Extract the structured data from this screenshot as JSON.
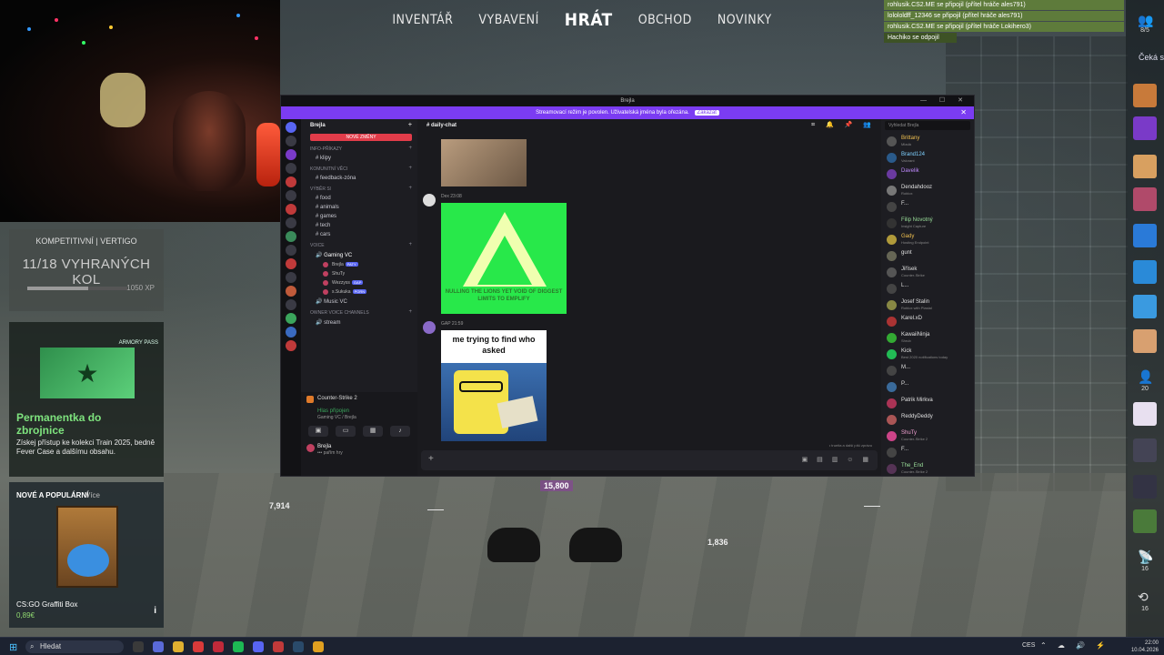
{
  "game": {
    "nav": [
      "INVENTÁŘ",
      "VYBAVENÍ",
      "HRÁT",
      "OBCHOD",
      "NOVINKY"
    ],
    "nav_active_index": 2,
    "competitive": {
      "title": "KOMPETITIVNÍ | VERTIGO",
      "wins": "11/18 VYHRANÝCH KOL",
      "xp": "1050 XP",
      "progress": 0.61
    },
    "pass": {
      "tag": "ARMORY PASS",
      "title": "Permanentka do zbrojnice",
      "text": "Získej přístup ke kolekci Train 2025, bedně Fever Case a dalšímu obsahu."
    },
    "new_popular": {
      "title": "NOVÉ A POPULÁRNÍ",
      "more": "Více",
      "item_name": "CS:GO Graffiti Box",
      "item_price": "0,89€"
    },
    "hud": {
      "money_1": "7,914",
      "money_2": "15,800",
      "money_3": "1,836",
      "blank_1": "——",
      "blank_2": "——"
    }
  },
  "chat_overlay": [
    "rohlusik.CS2.ME se připojil (přítel hráče ales791)",
    "lolololdff_12346 se připojil (přítel hráče ales791)",
    "rohlusik.CS2.ME se připojil (přítel hráče Lokihero3)",
    "Hachiko se odpojil"
  ],
  "right_bar": {
    "top_count": "8/5",
    "waiting": "Čeká s",
    "count_people": "20",
    "count_signal": "16",
    "count_history": "16"
  },
  "discord": {
    "title": "Brejla",
    "banner_text": "Streamovací režim je povolen. Uživatelská jména byla ořezána.",
    "banner_button": "Zakázat",
    "server_name": "Brejla",
    "new_messages": "NOVÉ ZMĚNY",
    "categories": [
      {
        "name": "INFO-PŘÍKAZY",
        "channels": [
          "klipy"
        ]
      },
      {
        "name": "KOMUNITNÍ VĚCI",
        "channels": [
          "feedback-zóna"
        ]
      },
      {
        "name": "VÝBĚR Sl",
        "channels": [
          "food",
          "animals",
          "games",
          "tech",
          "cars"
        ]
      },
      {
        "name": "VOICE",
        "channels": [
          "Gaming VC"
        ]
      }
    ],
    "voice_users": [
      {
        "name": "Brejla",
        "badge": "PATY"
      },
      {
        "name": "ShuTy",
        "badge": ""
      },
      {
        "name": "Wezzyss",
        "badge": "GAP"
      },
      {
        "name": "s.Sukuka",
        "badge": "PORN"
      }
    ],
    "music_vc": "Music VC",
    "owner_category": "OWNER VOICE CHANNELS",
    "stream_channel": "stream",
    "activity": "Counter-Strike 2",
    "voice_connected": "Hlas připojen",
    "voice_channel": "Gaming VC / Brejla",
    "user_name": "Brejla",
    "user_status": "••• pařím hry",
    "active_channel": "daily-chat",
    "search_placeholder": "Vyhledat Brejla",
    "msg_author_1": "Dex 23:08",
    "msg_author_2": "GAP 21:59",
    "green_caption": "NULLING THE LIONS YET VOID OF DIGGEST LIMITS TO EMPLIFY",
    "meme_text": "me trying to find who asked",
    "typing_text": "• trueita a další píší zprávu",
    "members": [
      {
        "name": "Brittany",
        "status": "Mladá",
        "color": "#f0c050",
        "av": "#555"
      },
      {
        "name": "Brand124",
        "status": "Valorant",
        "color": "#7ed0ff",
        "av": "#2a5a8a"
      },
      {
        "name": "Davelik",
        "status": "",
        "color": "#c08aff",
        "av": "#6a3aa0"
      },
      {
        "name": "Dendahdooz",
        "status": "Roblox",
        "color": "#e0e0e0",
        "av": "#777"
      },
      {
        "name": "F...",
        "status": "",
        "color": "#e0e0e0",
        "av": "#444"
      },
      {
        "name": "Filip Novotný",
        "status": "Insight Capture",
        "color": "#9adf9a",
        "av": "#333"
      },
      {
        "name": "Gady",
        "status": "Hosting Endpoint",
        "color": "#f0c050",
        "av": "#b09a3a"
      },
      {
        "name": "gunt",
        "status": "",
        "color": "#e0e0e0",
        "av": "#665"
      },
      {
        "name": "Jiřísek",
        "status": "Counter-Strike",
        "color": "#e0e0e0",
        "av": "#555"
      },
      {
        "name": "L...",
        "status": "",
        "color": "#e0e0e0",
        "av": "#444"
      },
      {
        "name": "Josef Stalin",
        "status": "Roblox with Plastal",
        "color": "#e0e0e0",
        "av": "#884"
      },
      {
        "name": "Karel.xD",
        "status": "",
        "color": "#e0e0e0",
        "av": "#a33"
      },
      {
        "name": "KawaiiNinja",
        "status": "Shrub",
        "color": "#e0e0e0",
        "av": "#3a3"
      },
      {
        "name": "Kick",
        "status": "Best 2020 notifications today",
        "color": "#e0e0e0",
        "av": "#2b5"
      },
      {
        "name": "M...",
        "status": "",
        "color": "#e0e0e0",
        "av": "#444"
      },
      {
        "name": "P...",
        "status": "",
        "color": "#e0e0e0",
        "av": "#3a6a9a"
      },
      {
        "name": "Patrik Mirkva",
        "status": "",
        "color": "#e0e0e0",
        "av": "#a35"
      },
      {
        "name": "ReddyDeddy",
        "status": "",
        "color": "#e0e0e0",
        "av": "#a55"
      },
      {
        "name": "ShuTy",
        "status": "Counter-Strike 2",
        "color": "#f0a0d0",
        "av": "#c48"
      },
      {
        "name": "F...",
        "status": "",
        "color": "#e0e0e0",
        "av": "#444"
      },
      {
        "name": "The_End",
        "status": "Counter-Strike 2",
        "color": "#9adf9a",
        "av": "#535"
      },
      {
        "name": "Wolfeer",
        "status": "",
        "color": "#e0e0e0",
        "av": "#666"
      }
    ]
  },
  "taskbar": {
    "search": "Hledat",
    "lang": "CES",
    "time": "22:00",
    "date": "10.04.2026"
  }
}
